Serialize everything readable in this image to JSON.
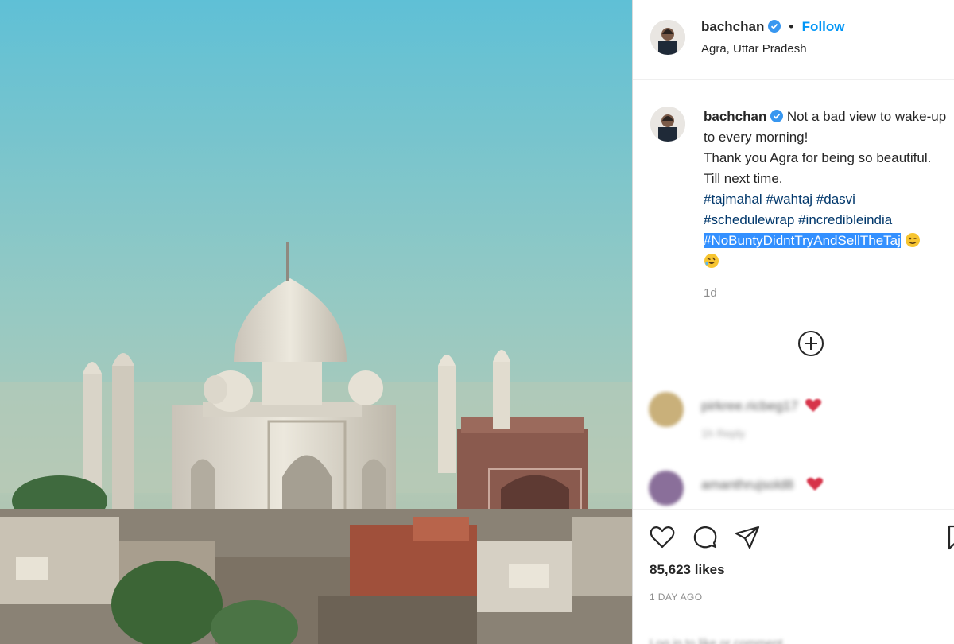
{
  "post": {
    "image_alt": "Taj Mahal view over Agra rooftops",
    "username": "bachchan",
    "follow_label": "Follow",
    "dot": "•",
    "location": "Agra, Uttar Pradesh"
  },
  "caption": {
    "username": "bachchan",
    "line1": "Not a bad view to wake-up to every morning!",
    "line2": "Thank you Agra for being so beautiful.",
    "line3": "Till next time.",
    "tags_row1": [
      "#tajmahal",
      "#wahtaj",
      "#dasvi"
    ],
    "tags_row2": [
      "#schedulewrap",
      "#incredibleindia"
    ],
    "highlighted_tag": "#NoBuntyDidntTryAndSellTheTaj",
    "time": "1d"
  },
  "comments": [
    {
      "username": "pirkree.ricbeg17",
      "sub": "1h  Reply"
    },
    {
      "username": "amanthrujsold8",
      "sub": ""
    }
  ],
  "footer": {
    "likes": "85,623 likes",
    "posted": "1 DAY AGO",
    "add_comment_placeholder": "Log in to like or comment."
  },
  "icons": {
    "like": "heart-icon",
    "comment": "comment-icon",
    "share": "paper-plane-icon",
    "save": "bookmark-icon",
    "more_comments": "plus-circle-icon",
    "verified": "verified-badge-icon"
  },
  "colors": {
    "follow": "#0095f6",
    "hashtag": "#00376b",
    "selection": "#3390ff",
    "muted": "#8e8e8e"
  }
}
